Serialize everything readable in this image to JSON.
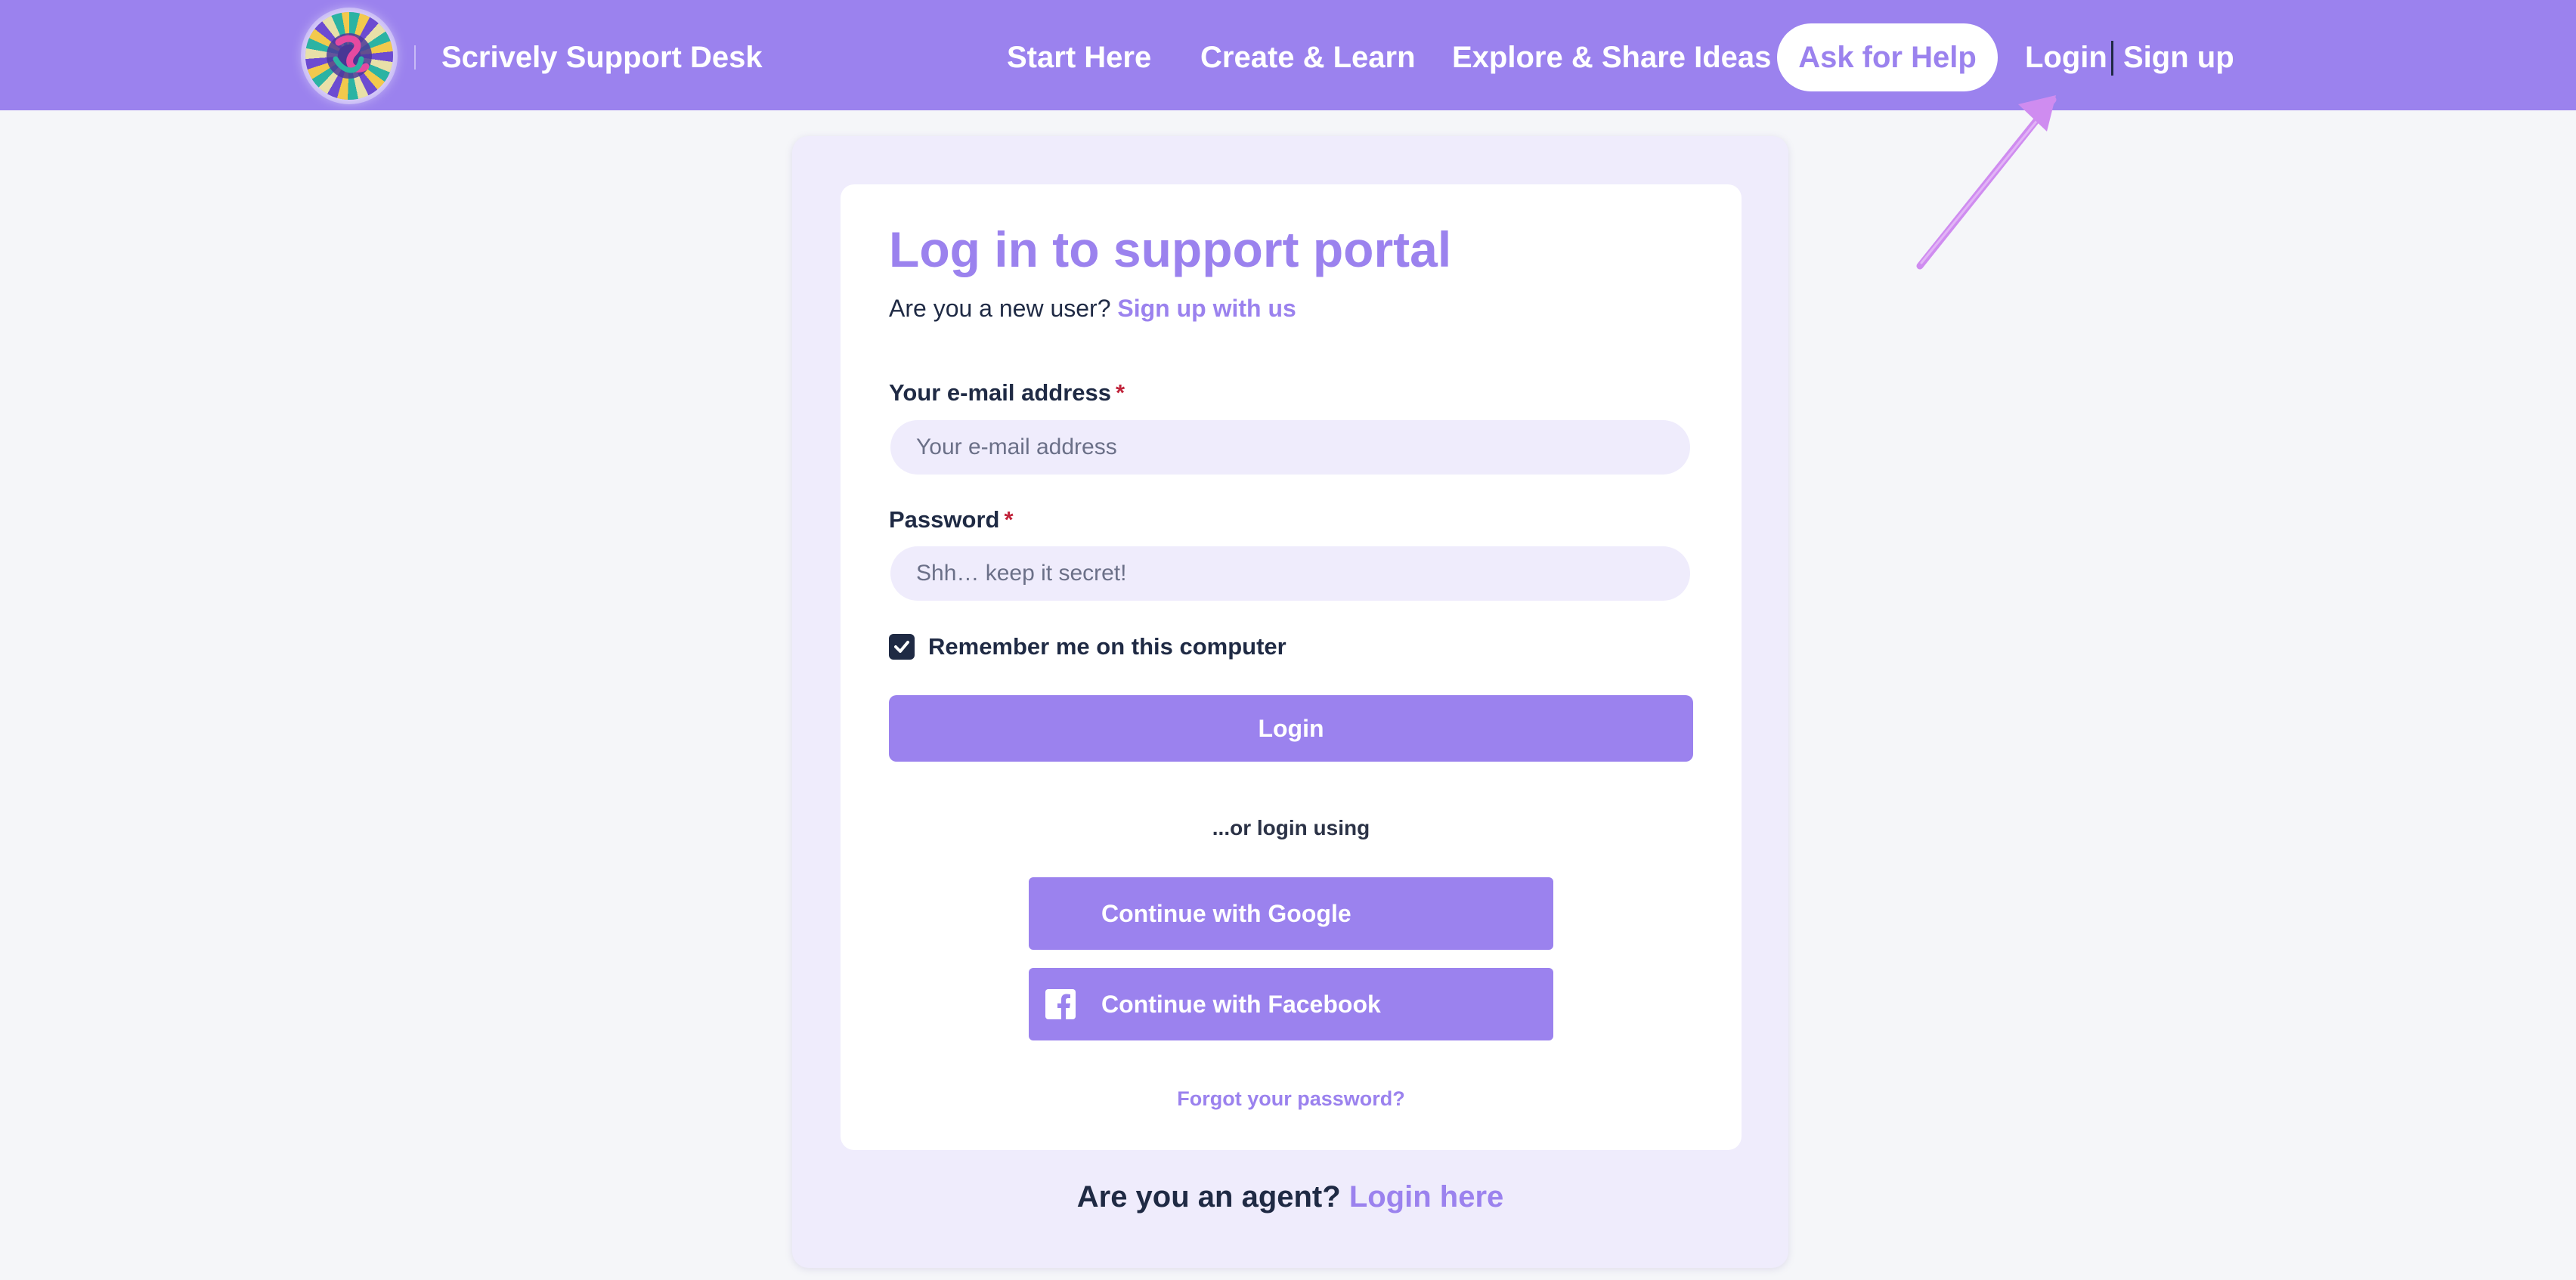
{
  "header": {
    "brand": "Scrively Support Desk",
    "nav": [
      {
        "label": "Start Here"
      },
      {
        "label": "Create & Learn"
      },
      {
        "label": "Explore & Share Ideas"
      }
    ],
    "help_button": "Ask for Help",
    "login_link": "Login",
    "signup_link": "Sign up"
  },
  "login_form": {
    "title": "Log in to support portal",
    "new_user_prompt": "Are you a new user?",
    "signup_link": "Sign up with us",
    "email": {
      "label": "Your e-mail address",
      "required_mark": "*",
      "placeholder": "Your e-mail address",
      "value": ""
    },
    "password": {
      "label": "Password",
      "required_mark": "*",
      "placeholder": "Shh… keep it secret!",
      "value": ""
    },
    "remember_me": {
      "label": "Remember me on this computer",
      "checked": true
    },
    "login_button": "Login",
    "or_login_using": "...or login using",
    "google_button": "Continue with Google",
    "facebook_button": "Continue with Facebook",
    "forgot_password": "Forgot your password?"
  },
  "agent_footer": {
    "prompt": "Are you an agent?",
    "link": "Login here"
  },
  "icons": {
    "logo": "scrively-logo",
    "checkbox": "check-icon",
    "facebook": "facebook-icon",
    "annotation": "arrow-annotation"
  },
  "colors": {
    "brand_purple": "#9b82ee",
    "light_lavender": "#efecfc",
    "page_background": "#f5f6f9",
    "text_dark": "#1f2a44",
    "required_red": "#c0233a",
    "arrow_pink": "#cf8cf0"
  }
}
